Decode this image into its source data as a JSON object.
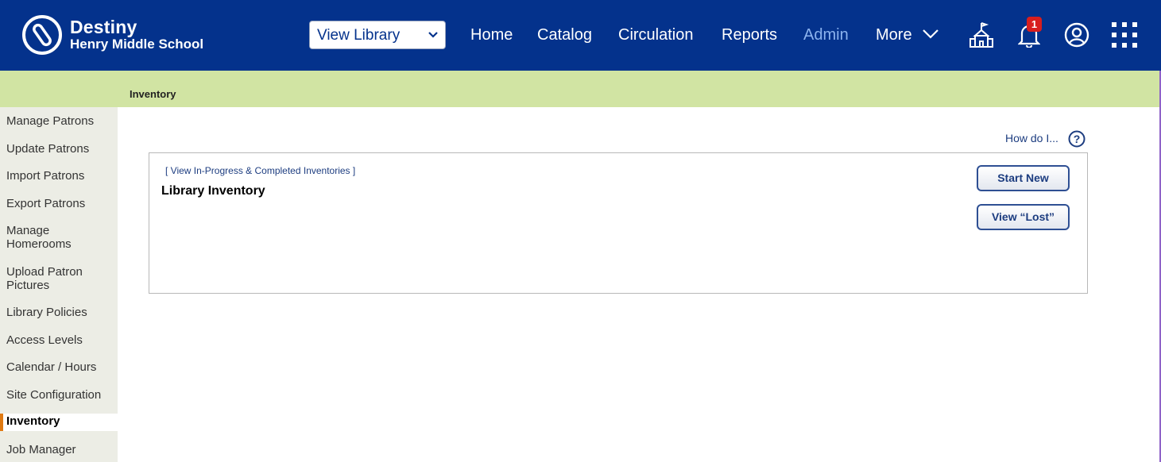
{
  "header": {
    "brand_title": "Destiny",
    "brand_subtitle": "Henry Middle School",
    "library_select": "View Library",
    "nav": [
      "Home",
      "Catalog",
      "Circulation",
      "Reports",
      "Admin",
      "More"
    ],
    "active_nav": "Admin",
    "notification_count": "1",
    "colors": {
      "bar": "#04328c",
      "active_link": "#8cb3ee",
      "badge": "#d81e1e"
    }
  },
  "breadcrumb": "Inventory",
  "sidebar": {
    "items": [
      "Manage Patrons",
      "Update Patrons",
      "Import Patrons",
      "Export Patrons",
      "Manage Homerooms",
      "Upload Patron Pictures",
      "Library Policies",
      "Access Levels",
      "Calendar / Hours",
      "Site Configuration",
      "Inventory",
      "Job Manager"
    ],
    "active_item": "Inventory"
  },
  "help": {
    "label": "How do I..."
  },
  "panel": {
    "view_link_prefix": "[ ",
    "view_link": "View In-Progress & Completed Inventories",
    "view_link_suffix": " ]",
    "title": "Library Inventory",
    "start_button": "Start New",
    "lost_button": "View “Lost”"
  },
  "icons": {
    "logo": "destiny-logo-icon",
    "school": "school-icon",
    "bell": "bell-icon",
    "user": "user-icon",
    "apps": "apps-grid-icon",
    "help": "help-icon"
  }
}
